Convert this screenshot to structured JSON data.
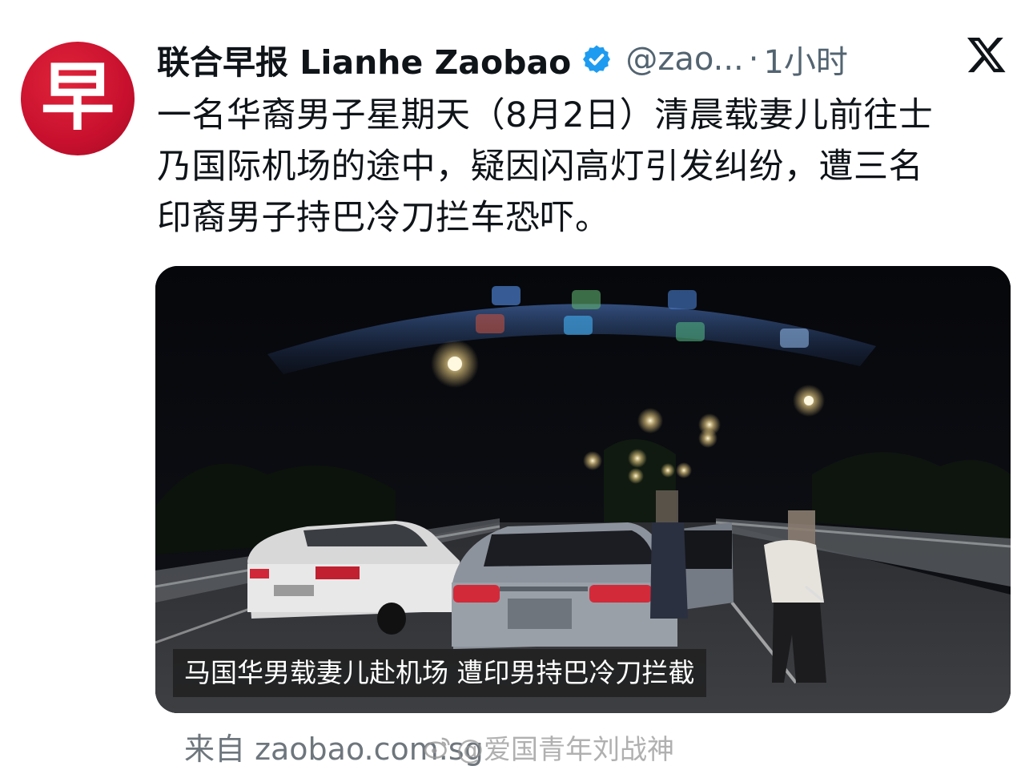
{
  "account": {
    "display_name": "联合早报 Lianhe Zaobao",
    "handle": "@zao...",
    "separator": "·",
    "time": "1小时",
    "avatar_glyph": "早",
    "avatar_color": "#c8102e",
    "verified_color": "#1d9bf0"
  },
  "tweet": {
    "lines": [
      "一名华裔男子星期天（8月2日）清晨载妻儿前往士",
      "乃国际机场的途中，疑因闪高灯引发纠纷，遭三名",
      "印裔男子持巴冷刀拦车恐吓。"
    ]
  },
  "media": {
    "caption": "马国华男载妻儿赴机场 遭印男持巴冷刀拦截"
  },
  "footer": {
    "source": "来自 zaobao.com.sg",
    "watermark": "@爱国青年刘战神"
  },
  "icons": {
    "platform": "x-logo-icon",
    "verified": "verified-badge-icon",
    "watermark": "weibo-icon"
  }
}
